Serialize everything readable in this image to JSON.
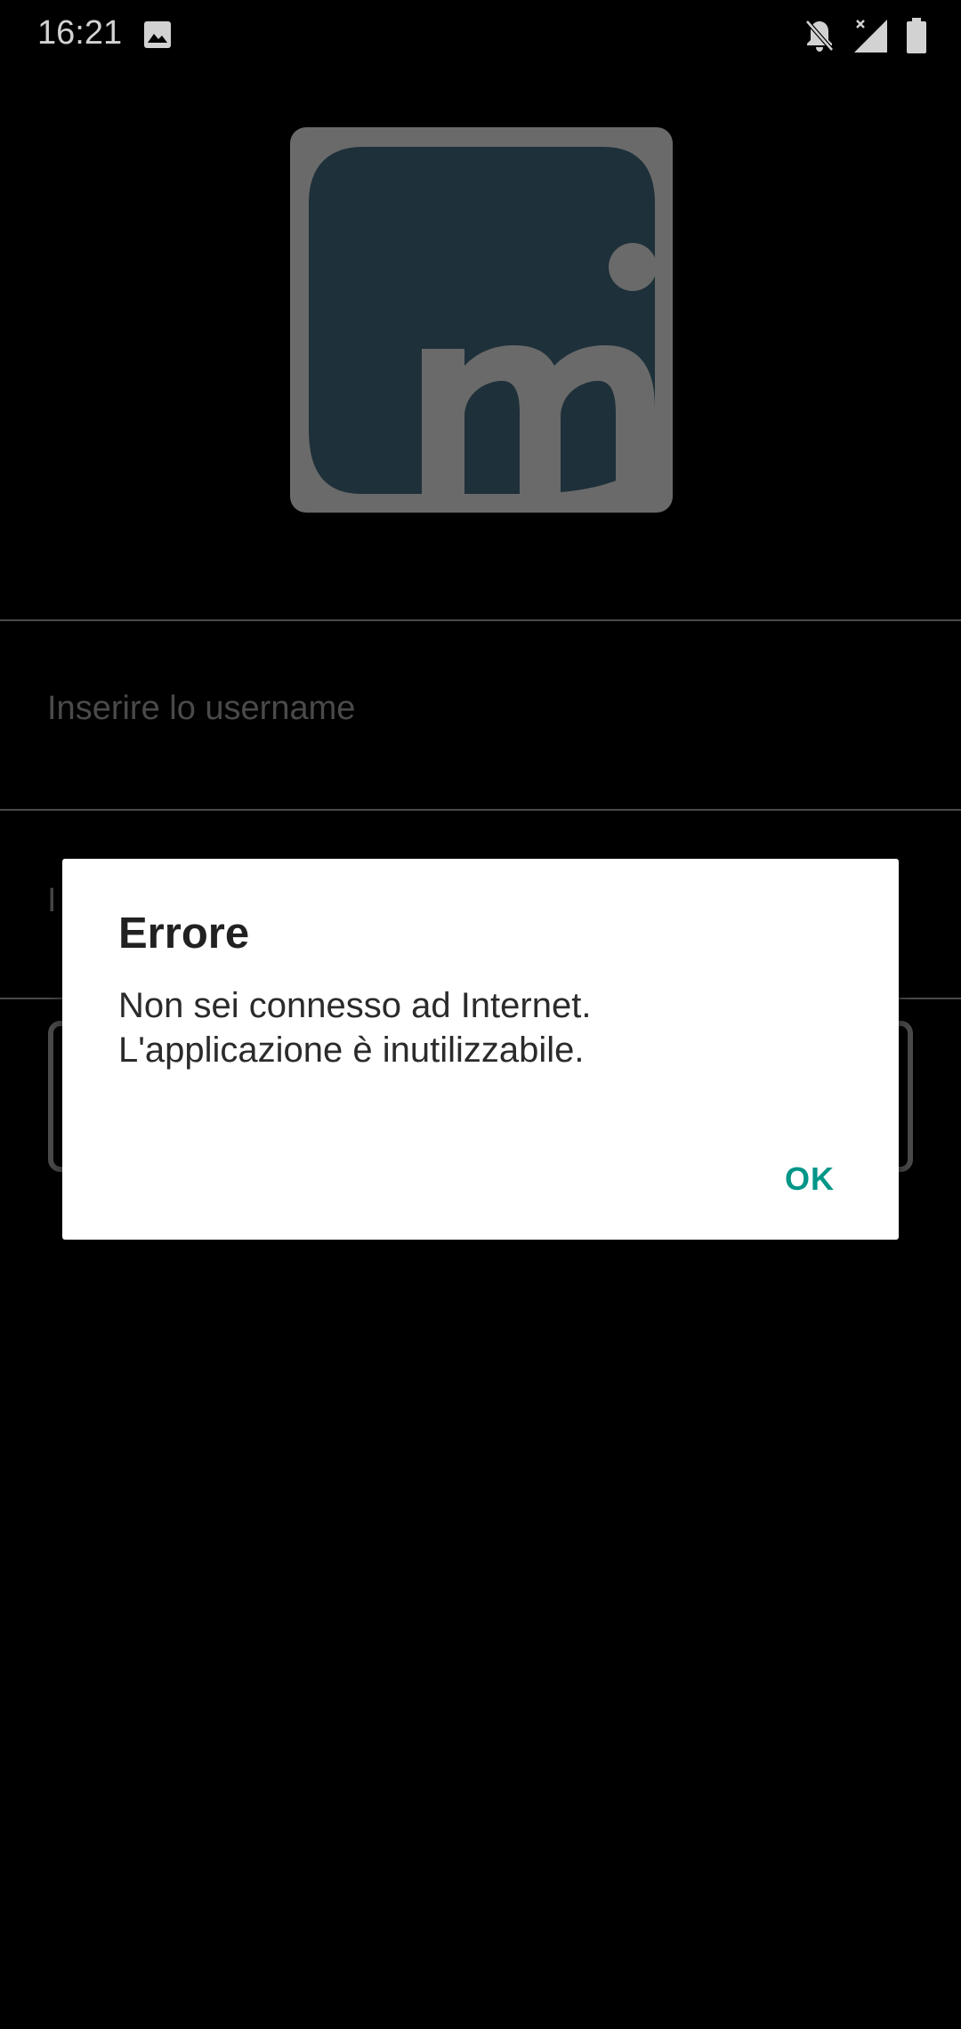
{
  "status_bar": {
    "time": "16:21",
    "icons": [
      "gallery-icon",
      "notifications-off-icon",
      "no-signal-icon",
      "battery-icon"
    ]
  },
  "login": {
    "username_placeholder": "Inserire lo username",
    "password_placeholder_visible": "I"
  },
  "dialog": {
    "title": "Errore",
    "message_line1": "Non sei connesso ad Internet.",
    "message_line2": "L'applicazione è inutilizzabile.",
    "ok_label": "OK"
  },
  "colors": {
    "background": "#000000",
    "dialog_background": "#ffffff",
    "accent": "#009688",
    "logo_tile": "#6a6a6a",
    "logo_shape": "#1e3039"
  }
}
